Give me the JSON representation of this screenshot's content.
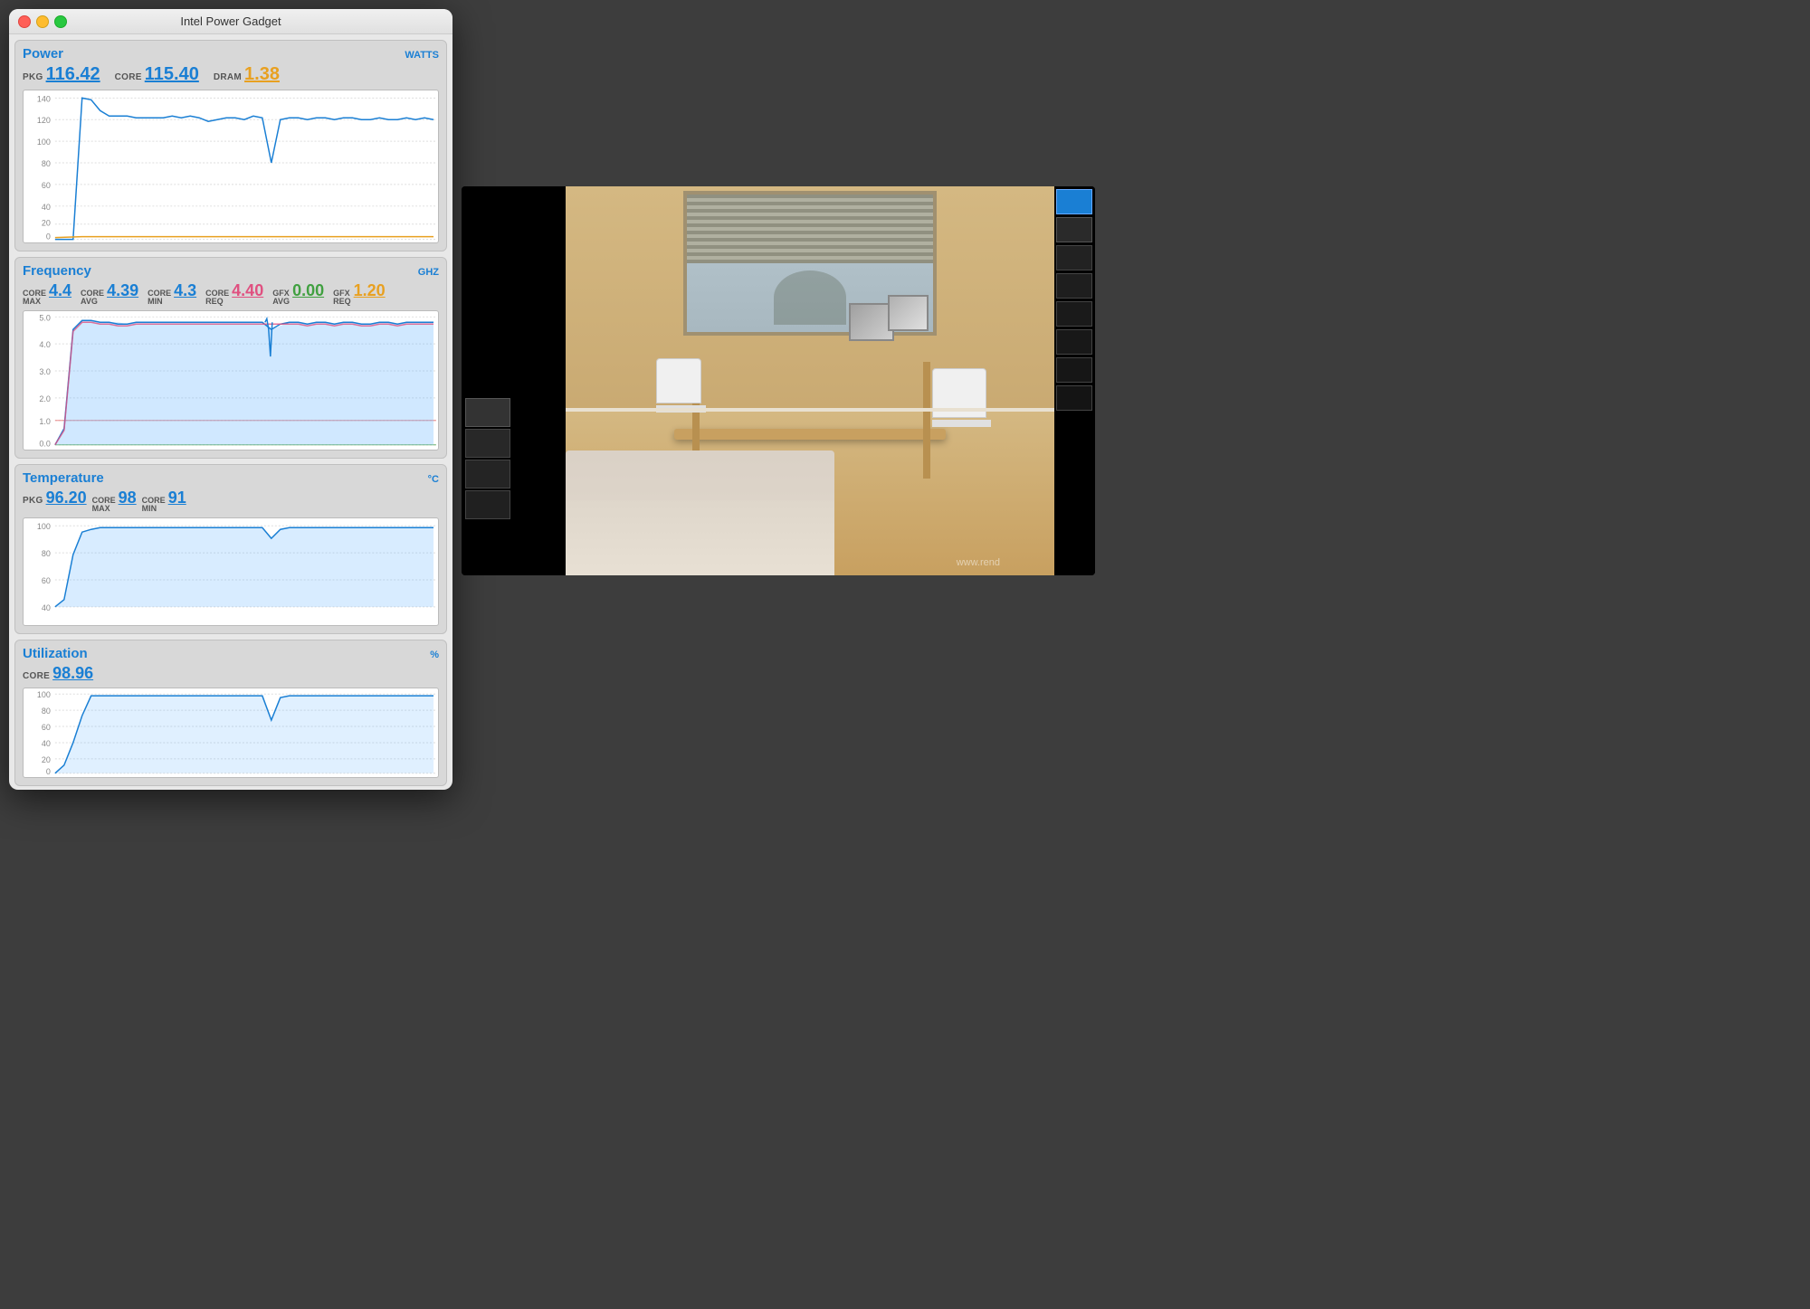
{
  "window": {
    "title": "Intel Power Gadget",
    "buttons": {
      "close": "close",
      "minimize": "minimize",
      "maximize": "maximize"
    }
  },
  "power": {
    "section_title": "Power",
    "unit": "WATTS",
    "pkg_label": "PKG",
    "pkg_value": "116.42",
    "core_label": "CORE",
    "core_value": "115.40",
    "dram_label": "DRAM",
    "dram_value": "1.38",
    "chart_y_max": 140,
    "chart_y_labels": [
      "140",
      "120",
      "100",
      "80",
      "60",
      "40",
      "20",
      "0"
    ]
  },
  "frequency": {
    "section_title": "Frequency",
    "unit": "GHZ",
    "stats": [
      {
        "label": "CORE MAX",
        "value": "4.4",
        "color": "blue"
      },
      {
        "label": "CORE AVG",
        "value": "4.39",
        "color": "blue"
      },
      {
        "label": "CORE MIN",
        "value": "4.3",
        "color": "blue"
      },
      {
        "label": "CORE REQ",
        "value": "4.40",
        "color": "pink"
      },
      {
        "label": "GFX AVG",
        "value": "0.00",
        "color": "green"
      },
      {
        "label": "GFX REQ",
        "value": "1.20",
        "color": "orange"
      }
    ],
    "chart_y_max": 5.0,
    "chart_y_labels": [
      "5.0",
      "4.0",
      "3.0",
      "2.0",
      "1.0",
      "0.0"
    ]
  },
  "temperature": {
    "section_title": "Temperature",
    "unit": "°C",
    "pkg_label": "PKG",
    "pkg_value": "96.20",
    "core_max_label": "CORE MAX",
    "core_max_value": "98",
    "core_min_label": "CORE MIN",
    "core_min_value": "91",
    "chart_y_labels": [
      "100",
      "80",
      "60",
      "40"
    ]
  },
  "utilization": {
    "section_title": "Utilization",
    "unit": "%",
    "core_label": "CORE",
    "core_value": "98.96",
    "chart_y_labels": [
      "100",
      "80",
      "60",
      "40",
      "20",
      "0"
    ]
  },
  "render": {
    "watermark": "www.rend"
  }
}
